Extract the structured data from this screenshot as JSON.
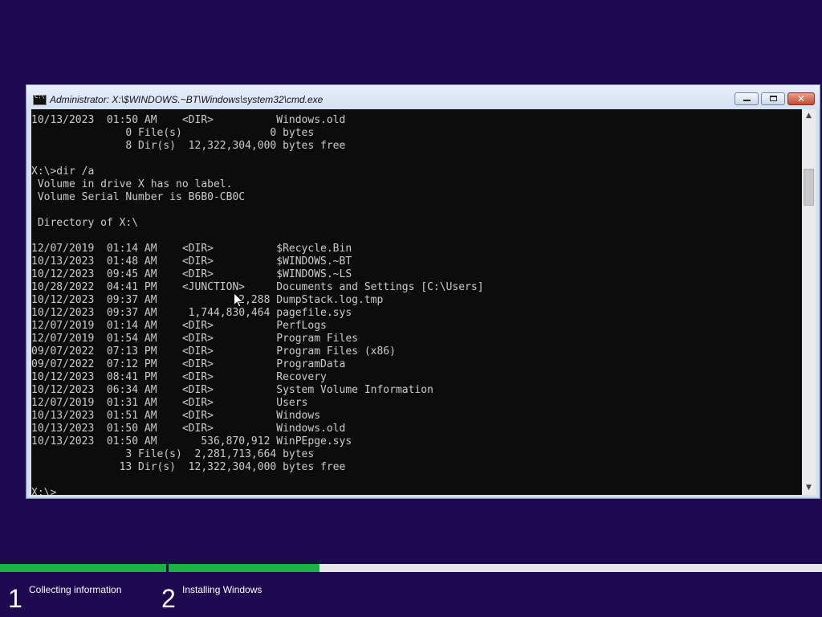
{
  "window": {
    "title": "Administrator: X:\\$WINDOWS.~BT\\Windows\\system32\\cmd.exe",
    "icon_text": "C:\\",
    "icon": "cmd-icon",
    "minimize_glyph": "minimize-icon",
    "maximize_glyph": "maximize-icon",
    "close_glyph": "✕"
  },
  "console": {
    "lines": [
      "10/13/2023  01:50 AM    <DIR>          Windows.old",
      "               0 File(s)              0 bytes",
      "               8 Dir(s)  12,322,304,000 bytes free",
      "",
      "X:\\>dir /a",
      " Volume in drive X has no label.",
      " Volume Serial Number is B6B0-CB0C",
      "",
      " Directory of X:\\",
      "",
      "12/07/2019  01:14 AM    <DIR>          $Recycle.Bin",
      "10/13/2023  01:48 AM    <DIR>          $WINDOWS.~BT",
      "10/12/2023  09:45 AM    <DIR>          $WINDOWS.~LS",
      "10/28/2022  04:41 PM    <JUNCTION>     Documents and Settings [C:\\Users]",
      "10/12/2023  09:37 AM            12,288 DumpStack.log.tmp",
      "10/12/2023  09:37 AM     1,744,830,464 pagefile.sys",
      "12/07/2019  01:14 AM    <DIR>          PerfLogs",
      "12/07/2019  01:54 AM    <DIR>          Program Files",
      "09/07/2022  07:13 PM    <DIR>          Program Files (x86)",
      "09/07/2022  07:12 PM    <DIR>          ProgramData",
      "10/12/2023  08:41 PM    <DIR>          Recovery",
      "10/12/2023  06:34 AM    <DIR>          System Volume Information",
      "12/07/2019  01:31 AM    <DIR>          Users",
      "10/13/2023  01:51 AM    <DIR>          Windows",
      "10/13/2023  01:50 AM    <DIR>          Windows.old",
      "10/13/2023  01:50 AM       536,870,912 WinPEpge.sys",
      "               3 File(s)  2,281,713,664 bytes",
      "              13 Dir(s)  12,322,304,000 bytes free",
      "",
      "X:\\>"
    ],
    "scroll_up_glyph": "▲",
    "scroll_down_glyph": "▼"
  },
  "setup": {
    "steps": [
      {
        "number": "1",
        "label": "Collecting information",
        "progress": 1.0
      },
      {
        "number": "2",
        "label": "Installing Windows",
        "progress": 0.231
      }
    ],
    "progress_color": "#1bb33f",
    "track_color": "#e6e6e6"
  },
  "colors": {
    "background": "#1e0850",
    "console_background": "#0c0c0c",
    "console_text": "#cccccc"
  }
}
